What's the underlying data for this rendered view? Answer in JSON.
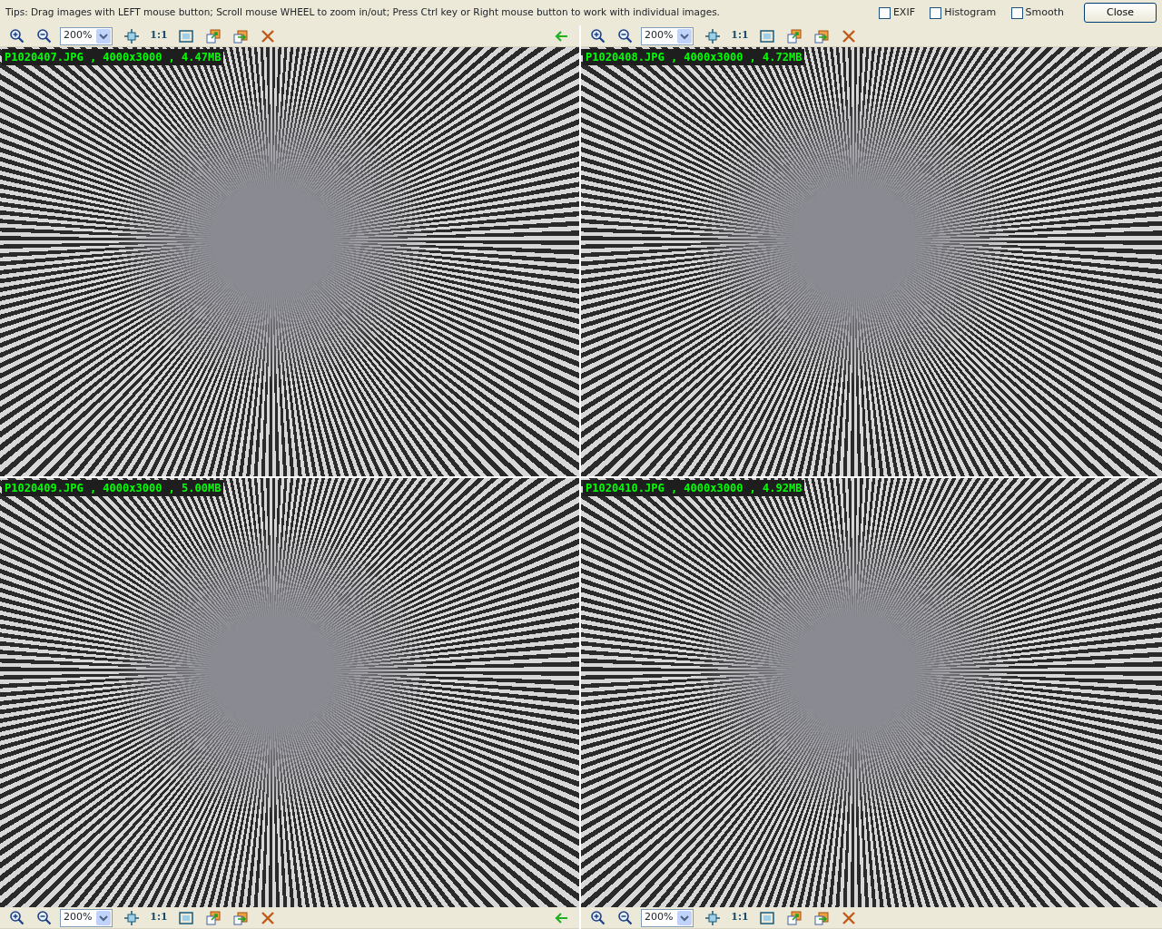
{
  "tips": "Tips: Drag images with LEFT mouse button; Scroll mouse WHEEL to zoom in/out; Press Ctrl key or Right mouse button to work with individual images.",
  "options": [
    {
      "label": "EXIF",
      "checked": false
    },
    {
      "label": "Histogram",
      "checked": false
    },
    {
      "label": "Smooth",
      "checked": false
    }
  ],
  "close_button": "Close",
  "panes": [
    {
      "zoom": "200%",
      "actual_size": "1:1",
      "back_arrow": true,
      "caption": "P1020407.JPG , 4000x3000 , 4.47MB"
    },
    {
      "zoom": "200%",
      "actual_size": "1:1",
      "back_arrow": false,
      "caption": "P1020408.JPG , 4000x3000 , 4.72MB"
    },
    {
      "zoom": "200%",
      "actual_size": "1:1",
      "back_arrow": true,
      "caption": "P1020409.JPG , 4000x3000 , 5.00MB"
    },
    {
      "zoom": "200%",
      "actual_size": "1:1",
      "back_arrow": false,
      "caption": "P1020410.JPG , 4000x3000 , 4.92MB"
    }
  ]
}
